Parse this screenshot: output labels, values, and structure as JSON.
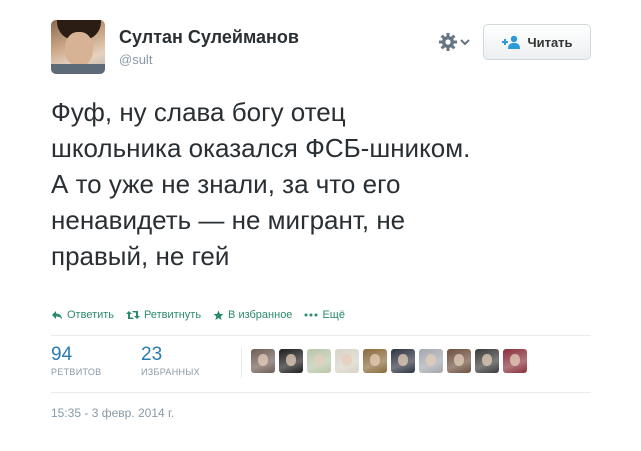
{
  "profile": {
    "name": "Султан Сулейманов",
    "handle": "@sult",
    "avatar_icon": "user-photo"
  },
  "header": {
    "gear_icon": "gear-icon",
    "follow_label": "Читать",
    "follow_icon": "add-user-icon"
  },
  "tweet": {
    "lines": [
      "Фуф, ну слава богу отец",
      "школьника оказался ФСБ-шником.",
      "А то уже не знали, за что его",
      "ненавидеть — не мигрант, не",
      "правый, не гей"
    ]
  },
  "actions": {
    "reply_label": "Ответить",
    "retweet_label": "Ретвитнуть",
    "favorite_label": "В избранное",
    "more_label": "Ещё"
  },
  "stats": {
    "retweets_count": "94",
    "retweets_label": "РЕТВИТОВ",
    "favorites_count": "23",
    "favorites_label": "ИЗБРАННЫХ"
  },
  "favoriters": [
    {
      "name": "faver-avatar-1",
      "color": "#6e5d55"
    },
    {
      "name": "faver-avatar-2",
      "color": "#1c1c1c"
    },
    {
      "name": "faver-avatar-3",
      "color": "#b8c6a8"
    },
    {
      "name": "faver-avatar-4",
      "color": "#d8d2c6"
    },
    {
      "name": "faver-avatar-5",
      "color": "#8a6a3a"
    },
    {
      "name": "faver-avatar-6",
      "color": "#2e3340"
    },
    {
      "name": "faver-avatar-7",
      "color": "#a4a8ae"
    },
    {
      "name": "faver-avatar-8",
      "color": "#6d4f3d"
    },
    {
      "name": "faver-avatar-9",
      "color": "#3a3a3a"
    },
    {
      "name": "faver-avatar-10",
      "color": "#8a2f3a"
    }
  ],
  "timestamp": "15:35 - 3 февр. 2014 г.",
  "colors": {
    "text": "#292f33",
    "muted": "#8899a6",
    "action": "#2a8a6a",
    "count": "#2a7ab0",
    "divider": "#e6ebee"
  }
}
